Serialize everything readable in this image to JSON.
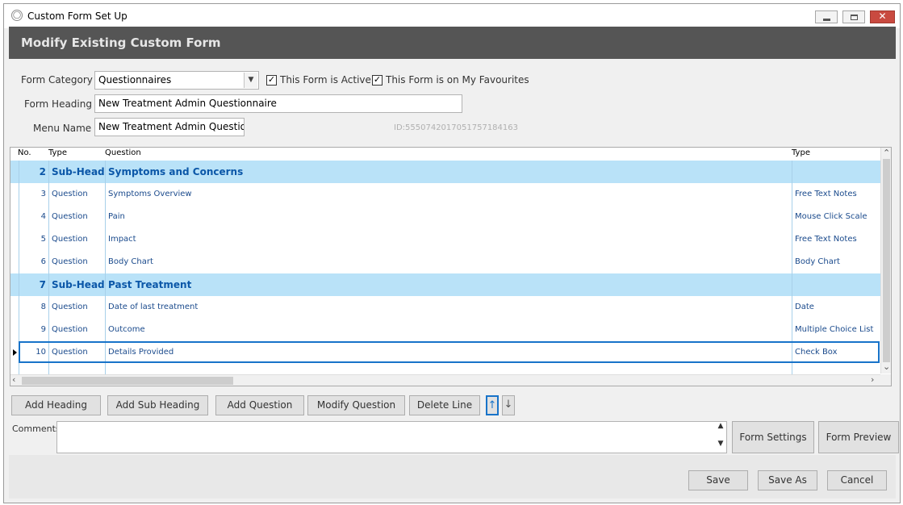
{
  "window": {
    "title": "Custom Form Set Up"
  },
  "header": {
    "title": "Modify Existing Custom Form"
  },
  "form": {
    "category_label": "Form Category",
    "category_value": "Questionnaires",
    "active_label": "This Form is Active",
    "active_checked": true,
    "favourites_label": "This Form is on My Favourites",
    "favourites_checked": true,
    "heading_label": "Form Heading",
    "heading_value": "New Treatment Admin Questionnaire",
    "menu_label": "Menu Name",
    "menu_value": "New Treatment Admin Questio",
    "id_text": "ID:555074201705175718416​3"
  },
  "grid": {
    "columns": {
      "no": "No.",
      "type": "Type",
      "question": "Question",
      "answer_type": "Type"
    },
    "rows": [
      {
        "no": "2",
        "type": "Sub-Headi",
        "question": "Symptoms and Concerns",
        "answer_type": "",
        "sub": true
      },
      {
        "no": "3",
        "type": "Question",
        "question": "Symptoms Overview",
        "answer_type": "Free Text Notes"
      },
      {
        "no": "4",
        "type": "Question",
        "question": "Pain",
        "answer_type": "Mouse Click Scale"
      },
      {
        "no": "5",
        "type": "Question",
        "question": "Impact",
        "answer_type": "Free Text Notes"
      },
      {
        "no": "6",
        "type": "Question",
        "question": "Body Chart",
        "answer_type": "Body Chart"
      },
      {
        "no": "7",
        "type": "Sub-Headi",
        "question": "Past Treatment",
        "answer_type": "",
        "sub": true
      },
      {
        "no": "8",
        "type": "Question",
        "question": "Date of last treatment",
        "answer_type": "Date"
      },
      {
        "no": "9",
        "type": "Question",
        "question": "Outcome",
        "answer_type": "Multiple Choice List"
      },
      {
        "no": "10",
        "type": "Question",
        "question": "Details Provided",
        "answer_type": "Check Box",
        "selected": true
      },
      {
        "no": "",
        "type": "",
        "question": "",
        "answer_type": ""
      }
    ]
  },
  "toolbar": {
    "add_heading": "Add Heading",
    "add_sub_heading": "Add Sub Heading",
    "add_question": "Add Question",
    "modify_question": "Modify Question",
    "delete_line": "Delete Line"
  },
  "comments": {
    "label": "Comments",
    "value": ""
  },
  "side_buttons": {
    "form_settings": "Form Settings",
    "form_preview": "Form Preview"
  },
  "footer": {
    "save": "Save",
    "save_as": "Save As",
    "cancel": "Cancel"
  },
  "icons": {
    "move_up": "arrow-up-icon",
    "move_down": "arrow-down-icon",
    "dropdown": "chevron-down-icon",
    "row_pointer": "triangle-right-icon"
  },
  "colors": {
    "header_band": "#555555",
    "subheading_row": "#b9e2f8",
    "grid_text": "#1a4a8c",
    "selection": "#1873c9",
    "close_button": "#c94a40"
  }
}
